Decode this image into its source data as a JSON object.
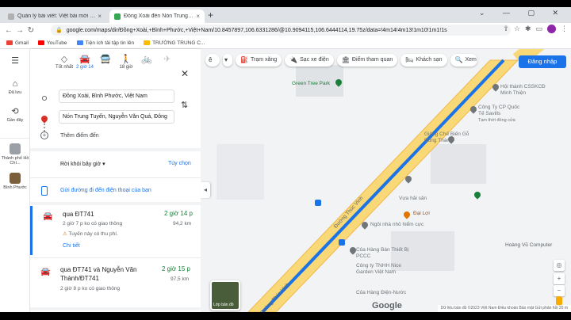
{
  "tabs": [
    {
      "title": "Quản lý bài viết: Việt bài mới - Ne"
    },
    {
      "title": "Đồng Xoài đến Nón Trung Tuyến"
    }
  ],
  "url": "google.com/maps/dir/Đồng+Xoài,+Bình+Phước,+Việt+Nam/10.8457897,106.6331286/@10.9094115,106.6444114,19.75z/data=!4m14!4m13!1m10!1m1!1s",
  "bookmarks": [
    "Gmail",
    "YouTube",
    "Tiện ích tải tập tin lên",
    "TRƯỜNG TRUNG C..."
  ],
  "rail": {
    "saved": "Đã lưu",
    "recent": "Gần đây",
    "place1": "Thành phố Hồ Chí...",
    "place2": "Bình Phước"
  },
  "modes": [
    {
      "label": "Tốt nhất",
      "icon": "◇"
    },
    {
      "label": "2 giờ 14",
      "icon": "🚗"
    },
    {
      "label": "",
      "icon": "🚌"
    },
    {
      "label": "18 giờ",
      "icon": "🚶"
    },
    {
      "label": "",
      "icon": "🚲"
    },
    {
      "label": "",
      "icon": "✈"
    }
  ],
  "origin": "Đồng Xoài, Bình Phước, Việt Nam",
  "destination": "Nón Trung Tuyến, Nguyễn Văn Quá, Đông",
  "add_stop": "Thêm điểm đến",
  "leave_now": "Rời khỏi bây giờ",
  "options": "Tùy chọn",
  "send_to_phone": "Gửi đường đi đến điện thoại của bạn",
  "routes": [
    {
      "name": "qua ĐT741",
      "time": "2 giờ 14 p",
      "sub": "2 giờ 7 p ko có giao thông",
      "dist": "94,2 km",
      "warn": "Tuyến này có thu phí.",
      "details": "Chi tiết"
    },
    {
      "name": "qua ĐT741 và Nguyễn Văn Thành/ĐT741",
      "time": "2 giờ 15 p",
      "sub": "2 giờ 8 p ko có giao thông",
      "dist": "97,5 km"
    }
  ],
  "map": {
    "chips": [
      "Trạm xăng",
      "Sạc xe điện",
      "Điểm tham quan",
      "Khách sạn",
      "Xem"
    ],
    "signin": "Đăng nhập",
    "layers": "Lớp bản đồ",
    "google": "Google",
    "attribution": "Dữ liệu bản đồ ©2023   Việt Nam   Điều khoản   Bảo mật   Gửi phản hồi   20 m",
    "street": "Đường Thúc Vinh",
    "pois": [
      "Green Tree Park",
      "Hội thánh CSSKCĐ Minh Thiện",
      "Công Ty CP Quốc Tế Savills",
      "Tạm thời đóng cửa",
      "Giông Chế Biến Gỗ Đông Thành",
      "Vựa hải sản",
      "Đại Lợi",
      "Ngôi nhà nhỏ hiểm cực",
      "Của Hàng Bán Thiết Bị PCCC",
      "Công ty TNHH Nice Garden Việt Nam",
      "Của Hàng Điện-Nước",
      "Hoàng Vũ Computer"
    ]
  }
}
